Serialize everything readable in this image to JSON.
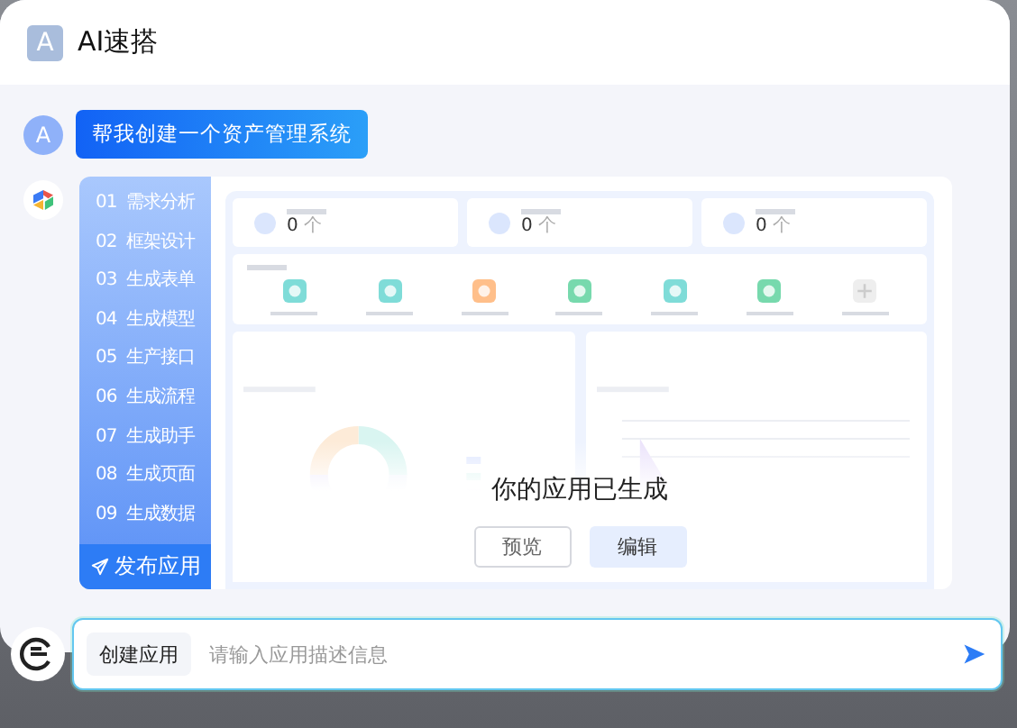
{
  "app": {
    "logo_letter": "A",
    "title": "AI速搭"
  },
  "message": {
    "avatar": "A",
    "text": "帮我创建一个资产管理系统"
  },
  "preview": {
    "steps": [
      {
        "number": "01",
        "label": "需求分析"
      },
      {
        "number": "02",
        "label": "框架设计"
      },
      {
        "number": "03",
        "label": "生成表单"
      },
      {
        "number": "04",
        "label": "生成模型"
      },
      {
        "number": "05",
        "label": "生产接口"
      },
      {
        "number": "06",
        "label": "生成流程"
      },
      {
        "number": "07",
        "label": "生成助手"
      },
      {
        "number": "08",
        "label": "生成页面"
      },
      {
        "number": "09",
        "label": "生成数据"
      }
    ],
    "publish_button": "发布应用",
    "stats": [
      {
        "value": "0",
        "unit": "个"
      },
      {
        "value": "0",
        "unit": "个"
      },
      {
        "value": "0",
        "unit": "个"
      }
    ],
    "app_icons": [
      {
        "kind": "app",
        "color": "#7fdcd8"
      },
      {
        "kind": "app",
        "color": "#7fdcd8"
      },
      {
        "kind": "app",
        "color": "#ffbf8a"
      },
      {
        "kind": "app",
        "color": "#77d9ad"
      },
      {
        "kind": "app",
        "color": "#7fdcd8"
      },
      {
        "kind": "app",
        "color": "#77d9ad"
      },
      {
        "kind": "add",
        "color": "#eeeeee"
      }
    ],
    "result_title": "你的应用已生成",
    "buttons": [
      {
        "label": "预览",
        "kind": "outline"
      },
      {
        "label": "编辑",
        "kind": "filled"
      }
    ]
  },
  "composer": {
    "mode_button": "创建应用",
    "placeholder": "请输入应用描述信息"
  }
}
